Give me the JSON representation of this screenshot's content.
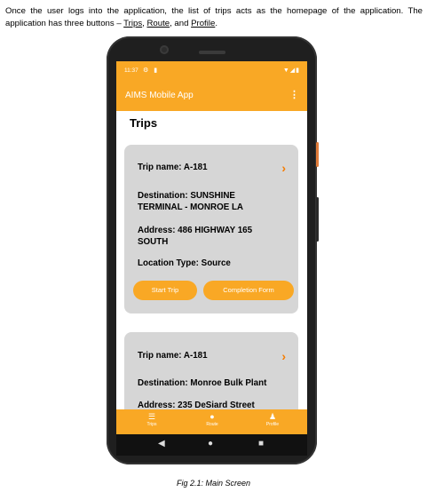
{
  "doc": {
    "intro_part1": "Once the user logs into the application, the list of trips acts as the homepage of the application. The application has three buttons – ",
    "link_trips": "Trips",
    "sep1": ", ",
    "link_route": "Route",
    "sep2": ", and ",
    "link_profile": "Profile",
    "end": ".",
    "caption": "Fig 2.1: Main Screen"
  },
  "statusbar": {
    "time": "11:37"
  },
  "appbar": {
    "title": "AIMS Mobile App",
    "more": "⋮"
  },
  "page": {
    "title": "Trips"
  },
  "trips": [
    {
      "name": "Trip name: A-181",
      "destination": "Destination: SUNSHINE TERMINAL - MONROE LA",
      "address": "Address: 486 HIGHWAY 165 SOUTH",
      "location_type": "Location Type: Source",
      "start_label": "Start Trip",
      "completion_label": "Completion Form"
    },
    {
      "name": "Trip name: A-181",
      "destination": "Destination: Monroe Bulk Plant",
      "address": "Address: 235 DeSiard Street"
    }
  ],
  "bottom_nav": [
    {
      "label": "Trips",
      "icon": "list-icon"
    },
    {
      "label": "Route",
      "icon": "location-pin-icon"
    },
    {
      "label": "Profile",
      "icon": "person-icon"
    }
  ],
  "colors": {
    "accent": "#f9a825",
    "chevron": "#f57c00",
    "card": "#d6d6d6"
  }
}
